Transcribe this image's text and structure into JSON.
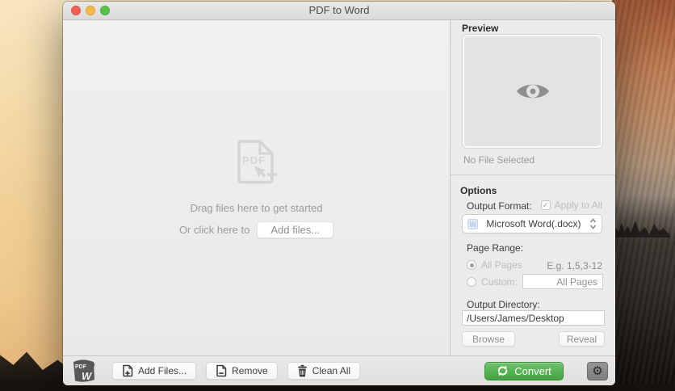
{
  "window": {
    "title": "PDF to Word"
  },
  "main": {
    "pdf_icon_label": "PDF",
    "drag_hint": "Drag files here to get started",
    "click_hint": "Or click here to",
    "add_files_button": "Add files..."
  },
  "preview": {
    "title": "Preview",
    "status": "No File Selected"
  },
  "options": {
    "title": "Options",
    "output_format_label": "Output Format:",
    "apply_to_all_label": "Apply to All",
    "apply_to_all_checked": true,
    "format_value": "Microsoft Word(.docx)",
    "page_range_label": "Page Range:",
    "all_pages_label": "All Pages",
    "all_pages_selected": true,
    "page_range_hint": "E.g. 1,5,3-12",
    "custom_label": "Custom:",
    "custom_selected": false,
    "custom_value": "All Pages",
    "output_directory_label": "Output Directory:",
    "output_directory_value": "/Users/James/Desktop",
    "browse_button": "Browse",
    "reveal_button": "Reveal"
  },
  "toolbar": {
    "app_icon_top": "PDF",
    "app_icon_bottom": "W",
    "add_files_button": "Add Files...",
    "remove_button": "Remove",
    "clean_all_button": "Clean All",
    "convert_button": "Convert"
  },
  "icons": {
    "check": "✓",
    "gear": "⚙"
  },
  "colors": {
    "traffic_red": "#ee6156",
    "traffic_yellow": "#f3ba4b",
    "traffic_green": "#58c24c",
    "convert_green_top": "#6fc36b",
    "convert_green_bottom": "#46a143"
  }
}
